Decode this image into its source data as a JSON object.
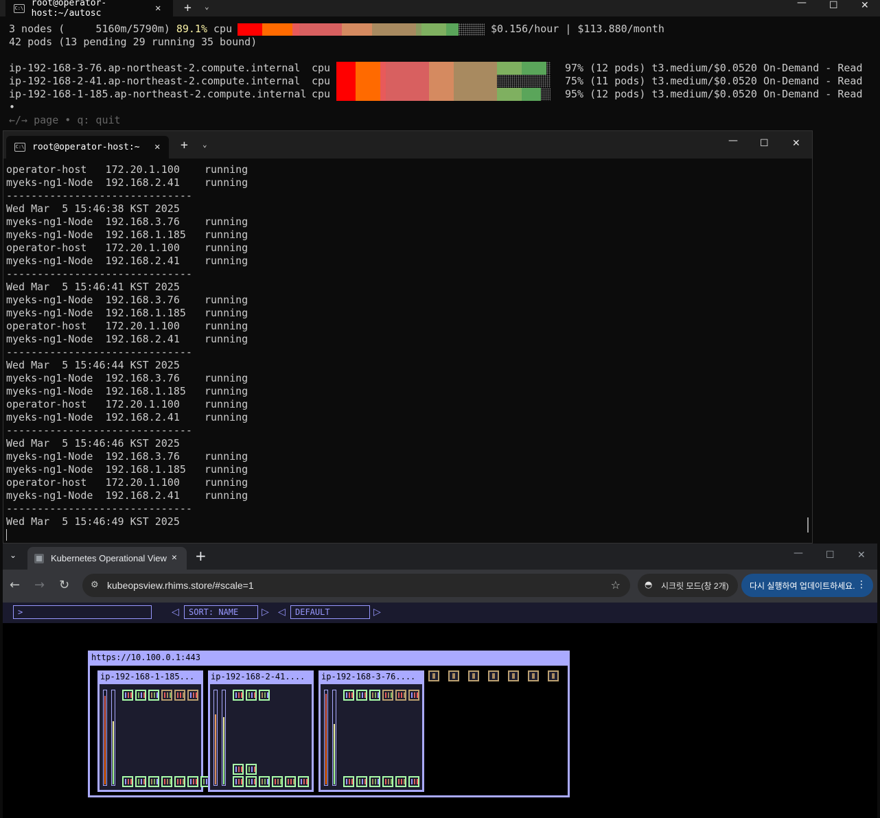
{
  "term1": {
    "tab_title": "root@operator-host:~/autosc",
    "summary_line1_a": "3 nodes (     5160m/5790m) ",
    "summary_pct": "89.1%",
    "summary_line1_b": " cpu",
    "cost": "$0.156/hour | $113.880/month",
    "summary_line2": "42 pods (13 pending 29 running 35 bound)",
    "nodes": [
      {
        "name": "ip-192-168-3-76.ap-northeast-2.compute.internal",
        "res": "cpu",
        "info": "97% (12 pods) t3.medium/$0.0520 On-Demand - Read",
        "util": 97
      },
      {
        "name": "ip-192-168-2-41.ap-northeast-2.compute.internal",
        "res": "cpu",
        "info": "75% (11 pods) t3.medium/$0.0520 On-Demand - Read",
        "util": 75
      },
      {
        "name": "ip-192-168-1-185.ap-northeast-2.compute.internal",
        "res": "cpu",
        "info": "95% (12 pods) t3.medium/$0.0520 On-Demand - Read",
        "util": 95
      }
    ],
    "bullet": "•",
    "help": "←/→ page • q: quit",
    "colors": {
      "bg": "#0c0c0c",
      "text": "#cccccc",
      "highlight": "#f9f1a5"
    }
  },
  "term2": {
    "tab_title": "root@operator-host:~",
    "lines": [
      "operator-host   172.20.1.100    running",
      "myeks-ng1-Node  192.168.2.41    running",
      "------------------------------",
      "Wed Mar  5 15:46:38 KST 2025",
      "myeks-ng1-Node  192.168.3.76    running",
      "myeks-ng1-Node  192.168.1.185   running",
      "operator-host   172.20.1.100    running",
      "myeks-ng1-Node  192.168.2.41    running",
      "------------------------------",
      "Wed Mar  5 15:46:41 KST 2025",
      "myeks-ng1-Node  192.168.3.76    running",
      "myeks-ng1-Node  192.168.1.185   running",
      "operator-host   172.20.1.100    running",
      "myeks-ng1-Node  192.168.2.41    running",
      "------------------------------",
      "Wed Mar  5 15:46:44 KST 2025",
      "myeks-ng1-Node  192.168.3.76    running",
      "myeks-ng1-Node  192.168.1.185   running",
      "operator-host   172.20.1.100    running",
      "myeks-ng1-Node  192.168.2.41    running",
      "------------------------------",
      "Wed Mar  5 15:46:46 KST 2025",
      "myeks-ng1-Node  192.168.3.76    running",
      "myeks-ng1-Node  192.168.1.185   running",
      "operator-host   172.20.1.100    running",
      "myeks-ng1-Node  192.168.2.41    running",
      "------------------------------",
      "Wed Mar  5 15:46:49 KST 2025"
    ]
  },
  "browser": {
    "tab_title": "Kubernetes Operational View",
    "url": "kubeopsview.rhims.store/#scale=1",
    "incognito_label": "시크릿 모드(창 2개)",
    "update_label": "다시 실행하여 업데이트하세요.",
    "app": {
      "filter_placeholder": ">",
      "sort_label": "SORT: NAME",
      "theme_label": "DEFAULT",
      "cluster_title": "https://10.100.0.1:443",
      "nodes": [
        {
          "name": "ip-192-168-1-185...",
          "cpu_fraction": 0.95,
          "mem_fraction": 0.68
        },
        {
          "name": "ip-192-168-2-41....",
          "cpu_fraction": 0.75,
          "mem_fraction": 0.72
        },
        {
          "name": "ip-192-168-3-76....",
          "cpu_fraction": 0.97,
          "mem_fraction": 0.65
        }
      ],
      "unassigned_pod_count": 7,
      "colors": {
        "frame": "#aaaaff",
        "pod_ok": "#aaffaa",
        "pod_pending": "#bba070"
      }
    }
  }
}
